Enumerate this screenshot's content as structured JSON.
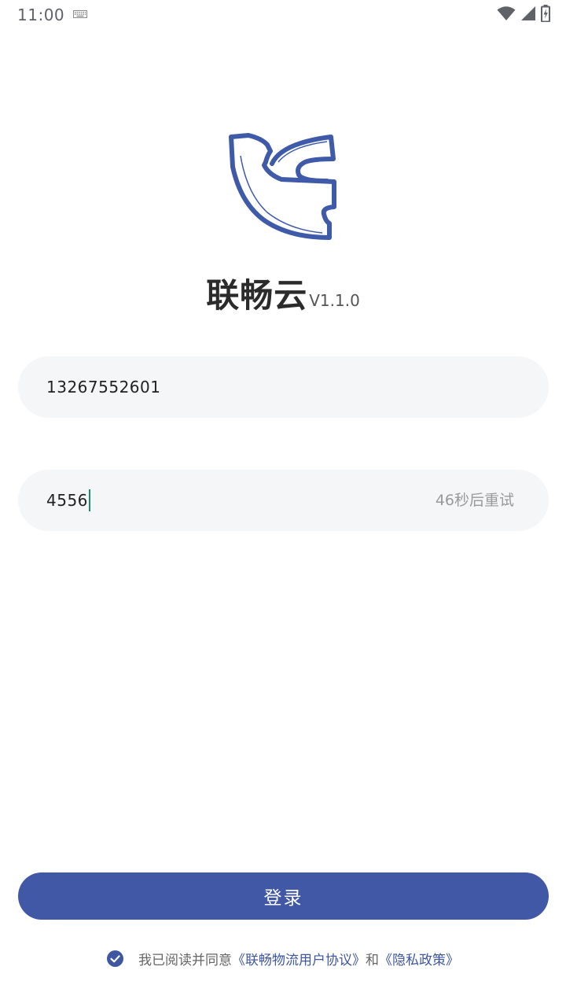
{
  "status_bar": {
    "time": "11:00",
    "icons": [
      "keyboard-icon",
      "wifi-icon",
      "signal-icon",
      "battery-charging-icon"
    ]
  },
  "app": {
    "name": "联畅云",
    "version": "V1.1.0",
    "logo": "lianchang-logo",
    "brand_color": "#4058a6"
  },
  "login_form": {
    "phone_value": "13267552601",
    "code_value": "4556",
    "resend_label": "46秒后重试",
    "field_background": "#f5f6f8",
    "login_label": "登录"
  },
  "agreement": {
    "checked": true,
    "prefix": "我已阅读并同意",
    "user_agreement_link": "《联畅物流用户协议》",
    "conjunction": "和",
    "privacy_policy_link": "《隐私政策》"
  }
}
